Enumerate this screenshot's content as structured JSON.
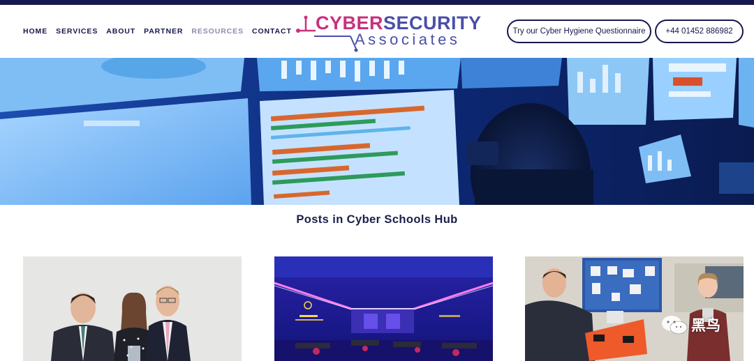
{
  "header": {
    "nav": [
      {
        "label": "HOME",
        "active": false
      },
      {
        "label": "SERVICES",
        "active": false
      },
      {
        "label": "ABOUT",
        "active": false
      },
      {
        "label": "PARTNER",
        "active": false
      },
      {
        "label": "RESOURCES",
        "active": true
      },
      {
        "label": "CONTACT",
        "active": false
      }
    ],
    "logo": {
      "part1": "CYBER",
      "part2": "SECURITY",
      "sub": "Associates"
    },
    "questionnaire_button": "Try our Cyber Hygiene Questionnaire",
    "phone_button": "+44 01452 886982"
  },
  "main": {
    "title": "Posts in Cyber Schools Hub",
    "posts": [
      {
        "image": "three-people-award-photo"
      },
      {
        "image": "cyber-centre-room-photo"
      },
      {
        "image": "classroom-case-photo"
      }
    ]
  },
  "watermark": {
    "text": "黑鸟"
  },
  "colors": {
    "navy": "#15174d",
    "magenta": "#c8307d",
    "purple": "#4a4fa8",
    "muted": "#8b8da8"
  }
}
